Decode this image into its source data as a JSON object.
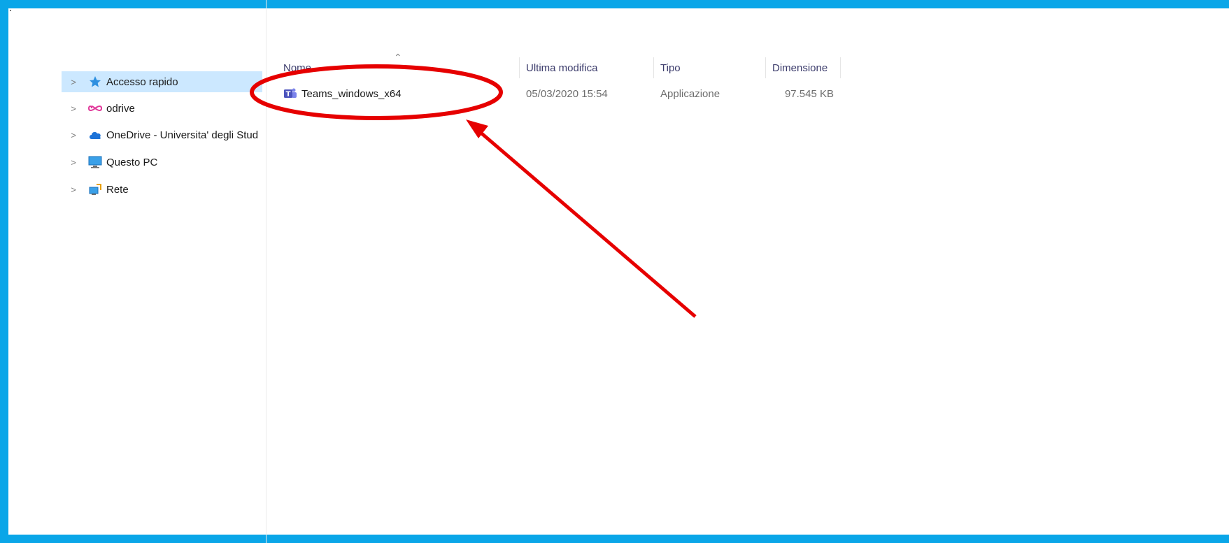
{
  "nav": {
    "items": [
      {
        "label": "Accesso rapido",
        "icon": "star-icon",
        "selected": true
      },
      {
        "label": "odrive",
        "icon": "infinity-icon",
        "selected": false
      },
      {
        "label": "OneDrive - Universita' degli Stud",
        "icon": "cloud-icon",
        "selected": false
      },
      {
        "label": "Questo PC",
        "icon": "computer-icon",
        "selected": false
      },
      {
        "label": "Rete",
        "icon": "network-icon",
        "selected": false
      }
    ]
  },
  "columns": {
    "name": "Nome",
    "modified": "Ultima modifica",
    "type": "Tipo",
    "size": "Dimensione"
  },
  "files": [
    {
      "name": "Teams_windows_x64",
      "modified": "05/03/2020 15:54",
      "type": "Applicazione",
      "size": "97.545 KB",
      "icon": "teams-icon"
    }
  ],
  "colors": {
    "frame": "#0aa6e8",
    "selection": "#cce8ff",
    "annotation": "#e60000"
  }
}
